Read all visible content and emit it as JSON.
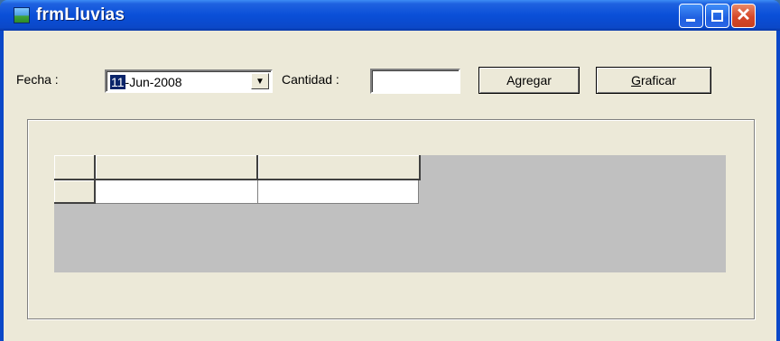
{
  "window": {
    "title": "frmLluvias",
    "app_icon": "form-icon",
    "controls": {
      "minimize": "minimize-icon",
      "maximize": "maximize-icon",
      "close": "close-icon"
    }
  },
  "form": {
    "fecha_label": "Fecha :",
    "date_value_day": "11",
    "date_value_rest": "-Jun-2008",
    "dropdown_icon": "chevron-down-icon",
    "dropdown_glyph": "▼",
    "cantidad_label": "Cantidad :",
    "cantidad_value": "",
    "agregar_label": "Agregar",
    "graficar_label": "Graficar"
  },
  "grid": {
    "columns": [
      "",
      ""
    ],
    "rows": [
      [
        "",
        ""
      ]
    ]
  },
  "colors": {
    "titlebar": "#0b48c8",
    "client": "#ece9d8",
    "grid_background": "#c0c0c0",
    "selection": "#0a246a"
  }
}
